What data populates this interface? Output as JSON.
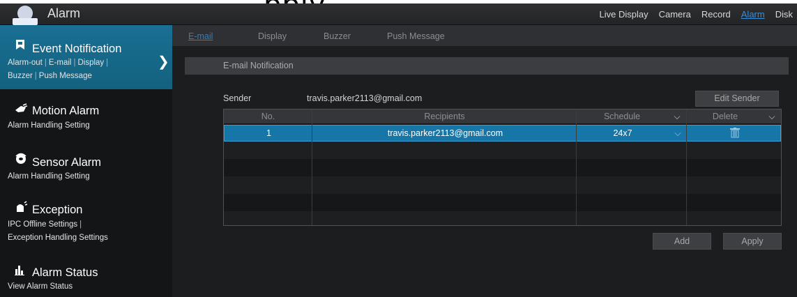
{
  "top_fragment": "pply",
  "app": {
    "title": "Alarm"
  },
  "topnav": [
    "Live Display",
    "Camera",
    "Record",
    "Alarm",
    "Disk"
  ],
  "sidebar": {
    "items": [
      {
        "title": "Event Notification",
        "subs": [
          "Alarm-out",
          "E-mail",
          "Display",
          "Buzzer",
          "Push Message"
        ]
      },
      {
        "title": "Motion Alarm",
        "sub": "Alarm Handling Setting"
      },
      {
        "title": "Sensor Alarm",
        "sub": "Alarm Handling Setting"
      },
      {
        "title": "Exception",
        "sub1": "IPC Offline Settings",
        "sub2": "Exception Handling Settings"
      },
      {
        "title": "Alarm Status",
        "sub": "View Alarm Status"
      }
    ]
  },
  "tabs": [
    "E-mail",
    "Display",
    "Buzzer",
    "Push Message"
  ],
  "section_title": "E-mail Notification",
  "sender": {
    "label": "Sender",
    "value": "travis.parker2113@gmail.com",
    "edit_label": "Edit Sender"
  },
  "table": {
    "headers": {
      "no": "No.",
      "recipients": "Recipients",
      "schedule": "Schedule",
      "delete": "Delete"
    },
    "rows": [
      {
        "no": "1",
        "recipient": "travis.parker2113@gmail.com",
        "schedule": "24x7"
      }
    ]
  },
  "buttons": {
    "add": "Add",
    "apply": "Apply"
  },
  "icons": {
    "logo": "camera-dome-icon",
    "event": "flag-icon",
    "motion": "motion-icon",
    "sensor": "sensor-icon",
    "exception": "alarm-light-icon",
    "status": "bar-chart-icon",
    "chevron": "chevron-right-icon",
    "dropdown": "chevron-down-icon",
    "delete": "trash-icon"
  },
  "colors": {
    "accent": "#1776a8",
    "sidebar_active": "#176a8c",
    "link_active": "#3a8fd8"
  }
}
